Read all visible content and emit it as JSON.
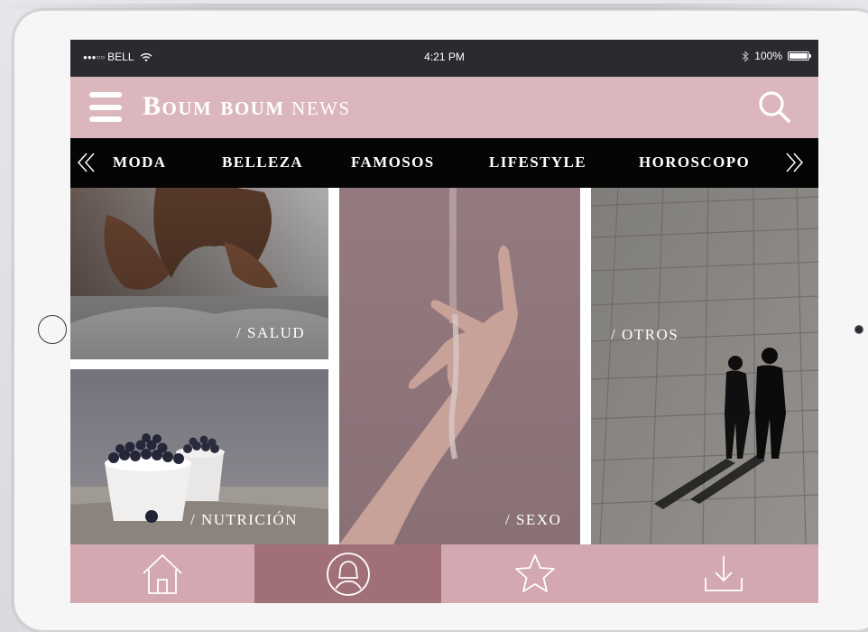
{
  "status_bar": {
    "carrier": "BELL",
    "signal": "●●●○○",
    "time": "4:21 PM",
    "battery": "100%"
  },
  "header": {
    "brand_bold": "Boum boum",
    "brand_light": "news",
    "menu_icon": "hamburger-menu-icon",
    "search_icon": "search-icon"
  },
  "categories": [
    {
      "label": "MODA"
    },
    {
      "label": "BELLEZA"
    },
    {
      "label": "FAMOSOS"
    },
    {
      "label": "LIFESTYLE"
    },
    {
      "label": "HOROSCOPO"
    }
  ],
  "tiles": [
    {
      "label": "/ SALUD"
    },
    {
      "label": "/ SEXO"
    },
    {
      "label": "/ OTROS"
    },
    {
      "label": "/ NUTRICIÓN"
    }
  ],
  "tabs": [
    {
      "icon": "home-icon",
      "active": false
    },
    {
      "icon": "profile-icon",
      "active": true
    },
    {
      "icon": "star-icon",
      "active": false
    },
    {
      "icon": "download-icon",
      "active": false
    }
  ],
  "colors": {
    "header": "#dbb7bd",
    "bottom_bar": "#d3a8b0",
    "active_tab": "#a16f78",
    "category_bar": "#050505",
    "status_bar": "#2b2b2f"
  }
}
